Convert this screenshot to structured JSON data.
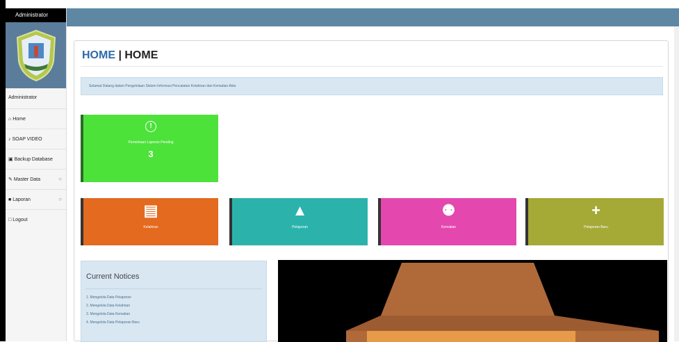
{
  "sidebar": {
    "header": "Administrator",
    "user_label": "Administrator",
    "items": [
      {
        "icon": "home-icon",
        "glyph": "⌂",
        "label": "Home"
      },
      {
        "icon": "sound-icon",
        "glyph": "♪",
        "label": "SOAP VIDEO"
      },
      {
        "icon": "image-icon",
        "glyph": "▣",
        "label": "Backup Database"
      },
      {
        "icon": "edit-icon",
        "glyph": "✎",
        "label": "Master Data"
      },
      {
        "icon": "file-icon",
        "glyph": "■",
        "label": "Laporan"
      },
      {
        "icon": "logout-icon",
        "glyph": "□",
        "label": "Logout"
      }
    ]
  },
  "header": {
    "title_primary": "HOME",
    "title_separator": " | ",
    "title_secondary": "HOME"
  },
  "alert": {
    "text": "Selamat Datang dalam Pengelolaan Sistem Informasi Pencatatan Kelahiran dan Kematian Akta"
  },
  "stat_tile": {
    "icon": "info-icon",
    "glyph": "!",
    "label": "Permintaan Laporan Pending",
    "value": "3",
    "color": "#4de23a"
  },
  "tiles": [
    {
      "icon": "book-icon",
      "glyph": "▤",
      "label": "Kelahiran",
      "color": "#e36a1e"
    },
    {
      "icon": "user-icon",
      "glyph": "▲",
      "label": "Pelaporan",
      "color": "#2bb3ab"
    },
    {
      "icon": "baby-carriage-icon",
      "glyph": "⚉",
      "label": "Kematian",
      "color": "#e447ad"
    },
    {
      "icon": "plus-icon",
      "glyph": "+",
      "label": "Pelaporan Baru",
      "color": "#a5a936"
    }
  ],
  "notices": {
    "heading": "Current Notices",
    "items": [
      "1. Mengelola Data Pelaporan",
      "2. Mengelola Data Kelahiran",
      "3. Mengelola Data Kematian",
      "4. Mengelola Data Pelaporan Baru"
    ]
  },
  "colors": {
    "topbar": "#5e87a4",
    "title_blue": "#2c6aa8",
    "roof": "#b06a3a",
    "wall": "#e79b4a"
  }
}
